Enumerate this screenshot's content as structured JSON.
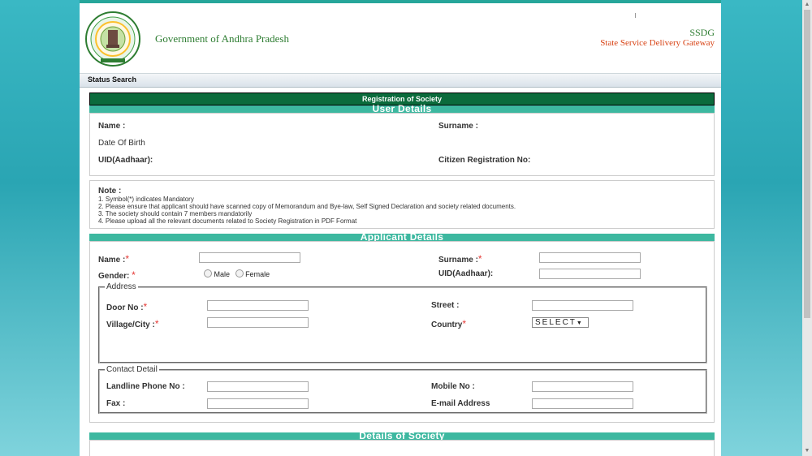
{
  "header": {
    "govt_title": "Government of Andhra Pradesh",
    "ssdg": "SSDG",
    "ssdg_full": "State Service Delivery Gateway"
  },
  "nav": {
    "status_search": "Status Search"
  },
  "form": {
    "title": "Registration of Society",
    "user_details": {
      "heading": "User Details",
      "name": "Name :",
      "surname": "Surname :",
      "dob": "Date Of Birth",
      "uid": "UID(Aadhaar):",
      "citizen_reg": "Citizen Registration No:"
    },
    "note": {
      "title": "Note :",
      "lines": [
        "1. Symbol(*) indicates Mandatory",
        "2. Please ensure that applicant should have scanned copy of Memorandum and Bye-law, Self Signed Declaration and society related documents.",
        "3. The society should contain 7 members mandatorily",
        "4. Please upload all the relevant documents related to Society Registration in PDF Format"
      ]
    },
    "applicant": {
      "heading": "Applicant Details",
      "name": "Name :",
      "surname": "Surname :",
      "gender": "Gender:",
      "male": "Male",
      "female": "Female",
      "uid": "UID(Aadhaar):",
      "address_legend": "Address",
      "door_no": "Door No :",
      "street": "Street :",
      "village_city": "Village/City :",
      "country": "Country",
      "country_value": "SELECT",
      "contact_legend": "Contact Detail",
      "landline": "Landline Phone No :",
      "mobile": "Mobile No :",
      "fax": "Fax :",
      "email": "E-mail Address"
    },
    "society": {
      "heading": "Details of Society"
    },
    "required_mark": "*"
  },
  "scroll": {
    "up": "▲",
    "down": "▼"
  }
}
